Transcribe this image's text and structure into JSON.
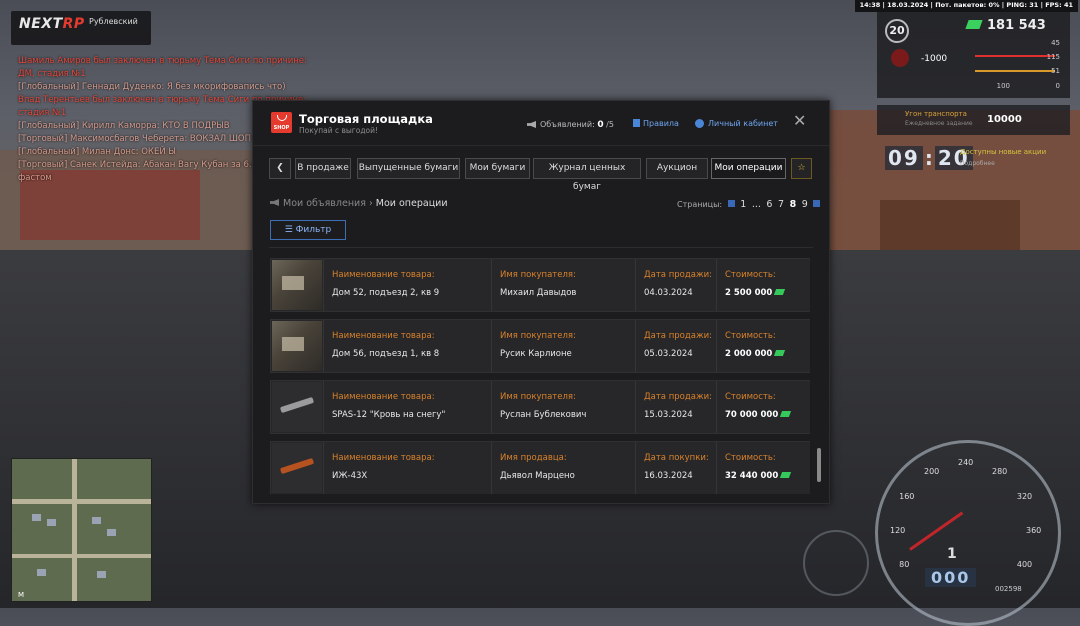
{
  "hud": {
    "status_bar": "14:38 | 18.03.2024 | Пот. пакетов: 0% | PING: 31 | FPS: 41",
    "logo_brand_a": "NEXT",
    "logo_brand_b": "RP",
    "server_name": "Рублевский",
    "level": "20",
    "money": "181 543",
    "debt": "-1000",
    "stat_1": "45",
    "stat_2": "115",
    "stat_3": "51",
    "stat_4": "100",
    "stat_5": "0",
    "task_title": "Угон транспорта",
    "task_sub": "Ежедневное задание",
    "task_amount": "10000",
    "clock_h": "09",
    "clock_m": "20",
    "quest_title": "Доступны новые акции",
    "quest_link": "Подробнее",
    "gear": "1",
    "speed_digits": "000",
    "odometer": "002598",
    "minimap_letter": "M"
  },
  "chat": [
    {
      "text": "Шамиль Амиров был заключен в тюрьму Тема Сиги по причине: ДМ, стадия №1",
      "color": "#e0463a"
    },
    {
      "text": "[Глобальный] Геннади Дуденко: Я без мкорифовапись что)",
      "color": "#d39a8c"
    },
    {
      "text": "Влад Терентьев был заключен в тюрьму Тема Сиги по причине: стадия №1",
      "color": "#e0463a"
    },
    {
      "text": "[Глобальный] Кирилл Каморра: КТО В ПОДРЫВ",
      "color": "#d39a8c"
    },
    {
      "text": "[Торговый] Максимосбагов Чеберета: ВОКЗАЛ ШОП",
      "color": "#d39a8c"
    },
    {
      "text": "[Глобальный] Милан Донс: ОКЕЙ Ы",
      "color": "#d39a8c"
    },
    {
      "text": "[Торговый] Санек Истейда: Абакан Вагу Кубан за 6.6",
      "color": "#d39a8c"
    },
    {
      "text": "фастом",
      "color": "#d39a8c"
    }
  ],
  "market": {
    "title": "Торговая площадка",
    "subtitle": "Покупай с выгодой!",
    "ads_label": "Объявлений:",
    "ads_count": "0",
    "ads_max": "/5",
    "rules_label": "Правила",
    "cabinet_label": "Личный кабинет",
    "close_symbol": "✕",
    "back_symbol": "❮",
    "star_symbol": "☆",
    "tabs": [
      "В продаже",
      "Выпущенные бумаги",
      "Мои бумаги",
      "Журнал ценных бумаг",
      "Аукцион",
      "Мои операции"
    ],
    "breadcrumb_parent": "Мои объявления",
    "breadcrumb_sep": "›",
    "breadcrumb_current": "Мои операции",
    "pages_label": "Страницы:",
    "pages": [
      "1",
      "...",
      "6",
      "7",
      "8",
      "9"
    ],
    "current_page": "8",
    "filter_label": "Фильтр",
    "rows": [
      {
        "thumb": "house",
        "name_label": "Наименование товара:",
        "name": "Дом 52, подъезд 2, кв 9",
        "party_label": "Имя покупателя:",
        "party": "Михаил Давыдов",
        "date_label": "Дата продажи:",
        "date": "04.03.2024",
        "price_label": "Стоимость:",
        "price": "2 500 000"
      },
      {
        "thumb": "house",
        "name_label": "Наименование товара:",
        "name": "Дом 56, подъезд 1, кв 8",
        "party_label": "Имя покупателя:",
        "party": "Русик Карлионе",
        "date_label": "Дата продажи:",
        "date": "05.03.2024",
        "price_label": "Стоимость:",
        "price": "2 000 000"
      },
      {
        "thumb": "gun",
        "name_label": "Наименование товара:",
        "name": "SPAS-12 \"Кровь на снегу\"",
        "party_label": "Имя покупателя:",
        "party": "Руслан Бублекович",
        "date_label": "Дата продажи:",
        "date": "15.03.2024",
        "price_label": "Стоимость:",
        "price": "70 000 000"
      },
      {
        "thumb": "gun-orange",
        "name_label": "Наименование товара:",
        "name": "ИЖ-43Х",
        "party_label": "Имя продавца:",
        "party": "Дьявол Марцено",
        "date_label": "Дата покупки:",
        "date": "16.03.2024",
        "price_label": "Стоимость:",
        "price": "32 440 000"
      }
    ]
  },
  "speedometer_ticks": [
    "80",
    "120",
    "160",
    "200",
    "240",
    "280",
    "320",
    "360",
    "400"
  ],
  "colors": {
    "accent_red": "#e53b2f",
    "label_orange": "#d9822b",
    "link_blue": "#6ea6f0",
    "money_green": "#35c85a"
  }
}
